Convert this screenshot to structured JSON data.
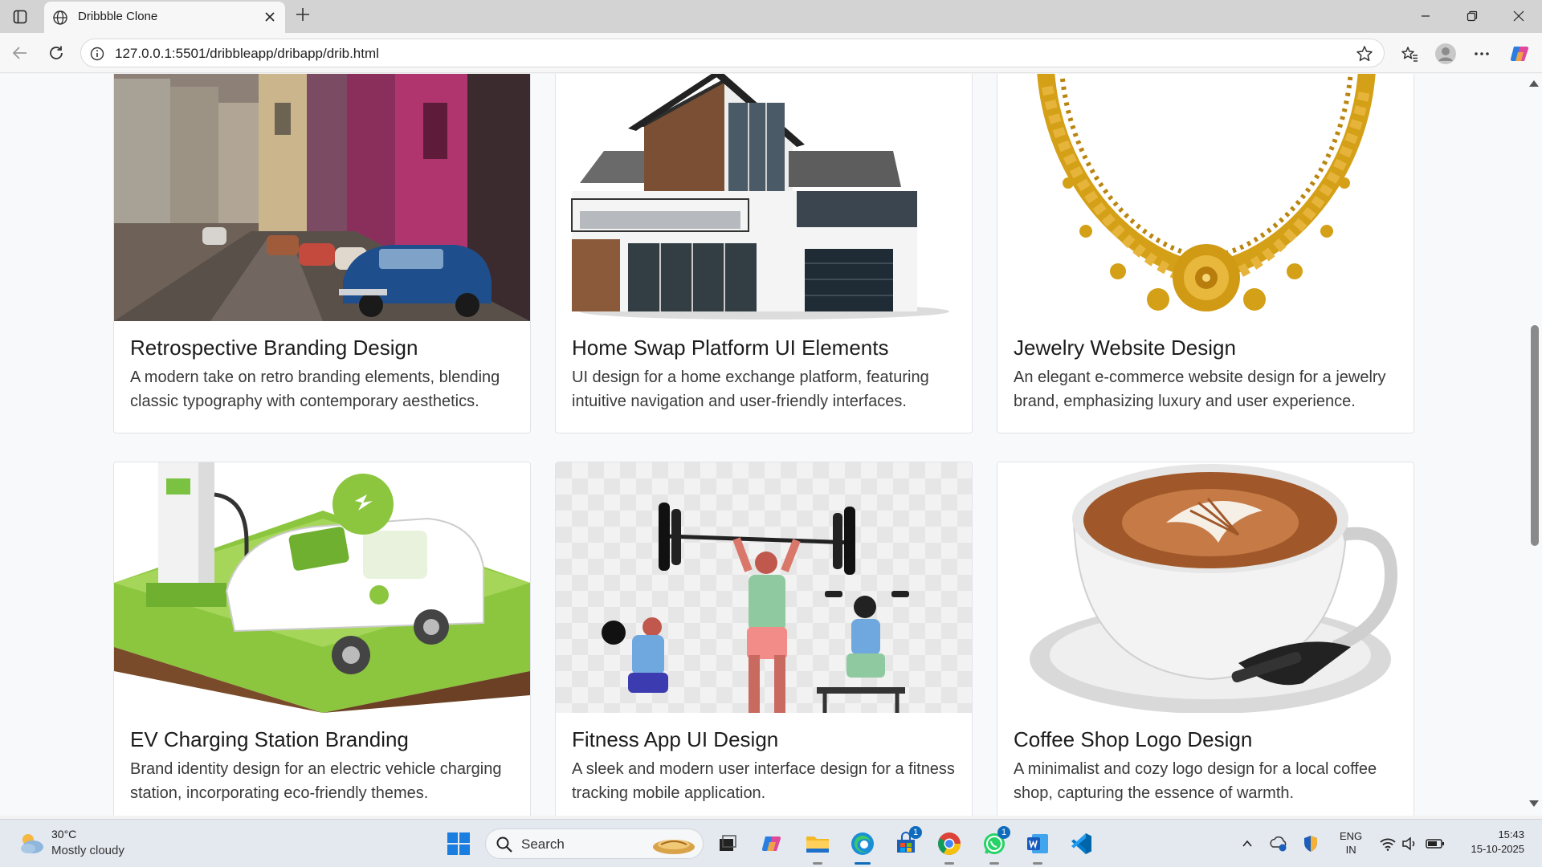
{
  "browser": {
    "tab_title": "Dribbble Clone",
    "url": "127.0.0.1:5501/dribbleapp/dribapp/drib.html"
  },
  "cards": [
    {
      "title": "Retrospective Branding Design",
      "description": "A modern take on retro branding elements, blending classic typography with contemporary aesthetics.",
      "image": "vintage-street-car"
    },
    {
      "title": "Home Swap Platform UI Elements",
      "description": "UI design for a home exchange platform, featuring intuitive navigation and user-friendly interfaces.",
      "image": "modern-house"
    },
    {
      "title": "Jewelry Website Design",
      "description": "An elegant e-commerce website design for a jewelry brand, emphasizing luxury and user experience.",
      "image": "gold-necklace"
    },
    {
      "title": "EV Charging Station Branding",
      "description": "Brand identity design for an electric vehicle charging station, incorporating eco-friendly themes.",
      "image": "ev-charging-car"
    },
    {
      "title": "Fitness App UI Design",
      "description": "A sleek and modern user interface design for a fitness tracking mobile application.",
      "image": "fitness-people"
    },
    {
      "title": "Coffee Shop Logo Design",
      "description": "A minimalist and cozy logo design for a local coffee shop, capturing the essence of warmth.",
      "image": "coffee-cup"
    }
  ],
  "taskbar": {
    "weather_temp": "30°C",
    "weather_desc": "Mostly cloudy",
    "search_label": "Search",
    "store_badge": "1",
    "whatsapp_badge": "1",
    "lang_line1": "ENG",
    "lang_line2": "IN",
    "time": "15:43",
    "date": "15-10-2025"
  },
  "colors": {
    "accent": "#0f6cbd",
    "page_background": "#f8f9fb",
    "card_border": "#e1e3e8"
  }
}
